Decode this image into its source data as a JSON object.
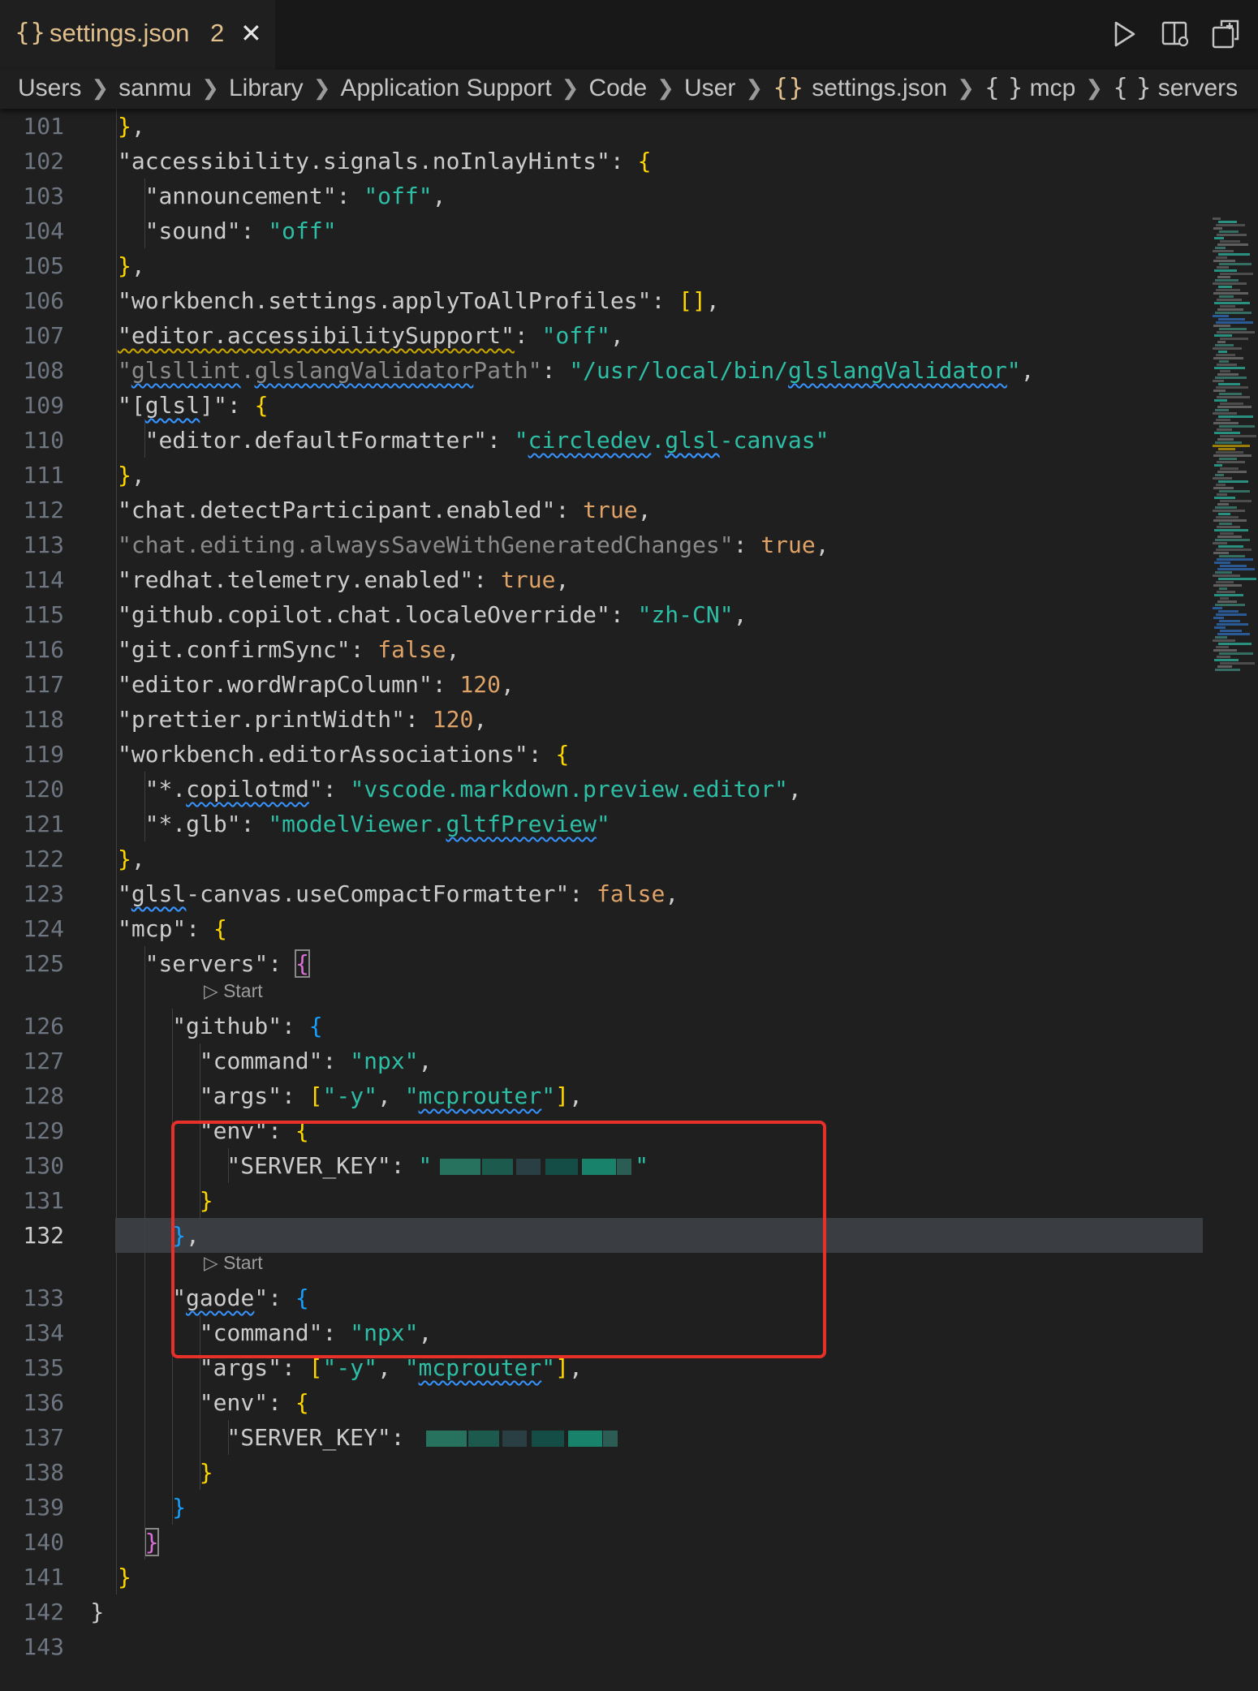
{
  "tab": {
    "icon_glyph": "{}",
    "filename": "settings.json",
    "problem_count": "2",
    "close_glyph": "✕",
    "color": "#e2c08d"
  },
  "toolbar_icons": [
    "run-icon",
    "split-editor-icon",
    "open-changes-icon"
  ],
  "breadcrumb": {
    "path": [
      "Users",
      "sanmu",
      "Library",
      "Application Support",
      "Code",
      "User"
    ],
    "file_icon": "{}",
    "file": "settings.json",
    "symbol_icon": "{ }",
    "symbols": [
      "mcp",
      "servers"
    ]
  },
  "editor": {
    "active_line": "132",
    "codelens_label": "Start",
    "codelens_glyph": "▷",
    "lines": [
      {
        "n": "101",
        "t": "},"
      },
      {
        "n": "102",
        "t": "\"accessibility.signals.noInlayHints\": {"
      },
      {
        "n": "103",
        "t": "\"announcement\": \"off\","
      },
      {
        "n": "104",
        "t": "\"sound\": \"off\""
      },
      {
        "n": "105",
        "t": "},"
      },
      {
        "n": "106",
        "t": "\"workbench.settings.applyToAllProfiles\": [],"
      },
      {
        "n": "107",
        "t": "\"editor.accessibilitySupport\": \"off\","
      },
      {
        "n": "108",
        "t": "\"glsllint.glslangValidatorPath\": \"/usr/local/bin/glslangValidator\","
      },
      {
        "n": "109",
        "t": "\"[glsl]\": {"
      },
      {
        "n": "110",
        "t": "\"editor.defaultFormatter\": \"circledev.glsl-canvas\""
      },
      {
        "n": "111",
        "t": "},"
      },
      {
        "n": "112",
        "t": "\"chat.detectParticipant.enabled\": true,"
      },
      {
        "n": "113",
        "t": "\"chat.editing.alwaysSaveWithGeneratedChanges\": true,"
      },
      {
        "n": "114",
        "t": "\"redhat.telemetry.enabled\": true,"
      },
      {
        "n": "115",
        "t": "\"github.copilot.chat.localeOverride\": \"zh-CN\","
      },
      {
        "n": "116",
        "t": "\"git.confirmSync\": false,"
      },
      {
        "n": "117",
        "t": "\"editor.wordWrapColumn\": 120,"
      },
      {
        "n": "118",
        "t": "\"prettier.printWidth\": 120,"
      },
      {
        "n": "119",
        "t": "\"workbench.editorAssociations\": {"
      },
      {
        "n": "120",
        "t": "\"*.copilotmd\": \"vscode.markdown.preview.editor\","
      },
      {
        "n": "121",
        "t": "\"*.glb\": \"modelViewer.gltfPreview\""
      },
      {
        "n": "122",
        "t": "},"
      },
      {
        "n": "123",
        "t": "\"glsl-canvas.useCompactFormatter\": false,"
      },
      {
        "n": "124",
        "t": "\"mcp\": {"
      },
      {
        "n": "125",
        "t": "\"servers\": {"
      },
      {
        "n": "126",
        "t": "\"github\": {"
      },
      {
        "n": "127",
        "t": "\"command\": \"npx\","
      },
      {
        "n": "128",
        "t": "\"args\": [\"-y\", \"mcprouter\"],"
      },
      {
        "n": "129",
        "t": "\"env\": {"
      },
      {
        "n": "130",
        "t": "\"SERVER_KEY\": \"[redacted]\""
      },
      {
        "n": "131",
        "t": "}"
      },
      {
        "n": "132",
        "t": "},"
      },
      {
        "n": "133",
        "t": "\"gaode\": {"
      },
      {
        "n": "134",
        "t": "\"command\": \"npx\","
      },
      {
        "n": "135",
        "t": "\"args\": [\"-y\", \"mcprouter\"],"
      },
      {
        "n": "136",
        "t": "\"env\": {"
      },
      {
        "n": "137",
        "t": "\"SERVER_KEY\": [redacted]"
      },
      {
        "n": "138",
        "t": "}"
      },
      {
        "n": "139",
        "t": "}"
      },
      {
        "n": "140",
        "t": "}"
      },
      {
        "n": "141",
        "t": "}"
      },
      {
        "n": "142",
        "t": "}"
      },
      {
        "n": "143",
        "t": ""
      }
    ]
  },
  "colors": {
    "background": "#1f1f1f",
    "string": "#2dbfa6",
    "bracket_gold": "#ffd700",
    "bracket_magenta": "#da70d6",
    "bracket_blue": "#179fff",
    "number_bool": "#e0a367",
    "highlight_box": "#e8302a"
  }
}
